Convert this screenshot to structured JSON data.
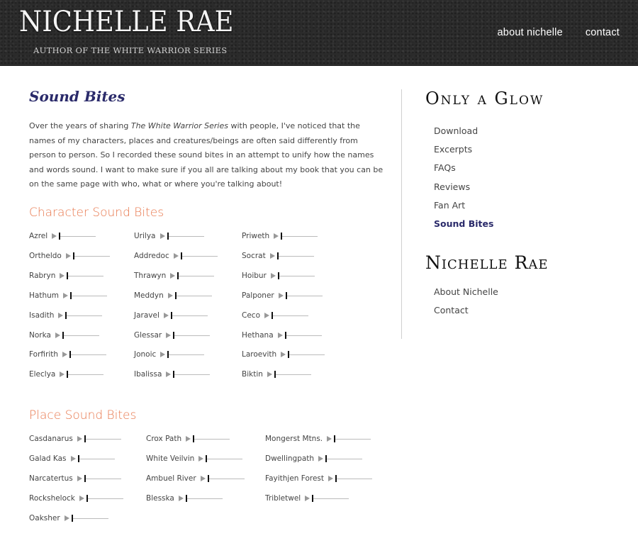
{
  "header": {
    "title": "NICHELLE RAE",
    "subtitle": "AUTHOR OF THE WHITE WARRIOR SERIES",
    "nav": [
      "about nichelle",
      "contact"
    ]
  },
  "main": {
    "title": "Sound Bites",
    "intro_before": "Over the years of sharing ",
    "intro_em": "The White Warrior Series",
    "intro_after": " with people, I've noticed that the names of my characters, places and creatures/beings are often said differently from person to person. So I recorded these sound bites in an attempt to unify how the names and words sound. I want to make sure if you all are talking about my book that you can be on the same page with who, what or where you're talking about!",
    "character_heading": "Character Sound Bites",
    "characters": [
      [
        "Azrel",
        "Ortheldo",
        "Rabryn",
        "Hathum",
        "Isadith",
        "Norka",
        "Forfirith",
        "Eleclya"
      ],
      [
        "Urilya",
        "Addredoc",
        "Thrawyn",
        "Meddyn",
        "Jaravel",
        "Glessar",
        "Jonoic",
        "Ibalissa"
      ],
      [
        "Priweth",
        "Socrat",
        "Hoibur",
        "Palponer",
        "Ceco",
        "Hethana",
        "Laroevith",
        "Biktin"
      ]
    ],
    "place_heading": "Place Sound Bites",
    "places": [
      [
        "Casdanarus",
        "Galad Kas",
        "Narcatertus",
        "Rockshelock",
        "Oaksher"
      ],
      [
        "Crox Path",
        "White Veilvin",
        "Ambuel River",
        "Blesska"
      ],
      [
        "Mongerst Mtns.",
        "Dwellingpath",
        "Fayithjen Forest",
        "Tribletwel"
      ]
    ]
  },
  "sidebar": {
    "book_heading": "Only a Glow",
    "book_links": [
      "Download",
      "Excerpts",
      "FAQs",
      "Reviews",
      "Fan Art",
      "Sound Bites"
    ],
    "active_link": "Sound Bites",
    "author_heading": "Nichelle Rae",
    "author_links": [
      "About Nichelle",
      "Contact"
    ]
  },
  "colors": {
    "header_bg": "#2b2b2b",
    "title_blue": "#2a2a6a",
    "section_orange": "#e8784e"
  },
  "icons": {
    "play": "play-icon",
    "audio_progress": "audio-progress-bar"
  }
}
